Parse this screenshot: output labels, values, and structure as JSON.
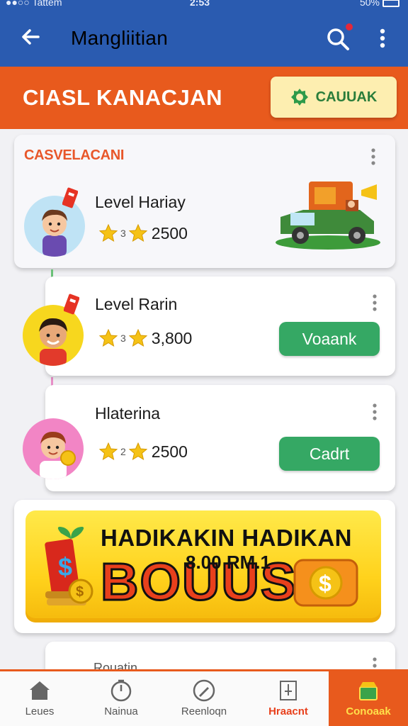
{
  "status_bar": {
    "carrier": "●●○○ Tattem",
    "time": "2:53",
    "battery": "50%"
  },
  "app_bar": {
    "title": "Mangliitian",
    "icons": [
      "back-arrow-icon",
      "search-icon",
      "more-vertical-icon"
    ]
  },
  "header": {
    "title": "CIASL KANACJAN",
    "button_label": "CAUUAK"
  },
  "section_label": "CASVELACANI",
  "levels": [
    {
      "title": "Level Hariay",
      "stars": "3",
      "score": "2500",
      "button": ""
    },
    {
      "title": "Level Rarin",
      "stars": "3",
      "score": "3,800",
      "button": "Voaank"
    },
    {
      "title": "Hlaterina",
      "stars": "2",
      "score": "2500",
      "button": "Cadrt"
    }
  ],
  "bonus": {
    "headline": "HADIKAKIN HADIKAN",
    "subline": "8.00 RM.1",
    "word": "BOUUS"
  },
  "peek_card_title": "Rouatin",
  "bottom_nav": [
    {
      "label": "Leues",
      "icon": "home-icon"
    },
    {
      "label": "Nainua",
      "icon": "timer-icon"
    },
    {
      "label": "Reenloqn",
      "icon": "edit-icon"
    },
    {
      "label": "Hraacnt",
      "icon": "stats-icon"
    },
    {
      "label": "Conoaak",
      "icon": "shop-icon"
    }
  ],
  "colors": {
    "app_bar": "#2a5bb0",
    "accent_orange": "#e85a1d",
    "button_green": "#35a864",
    "bonus_yellow": "#ffd21c"
  }
}
